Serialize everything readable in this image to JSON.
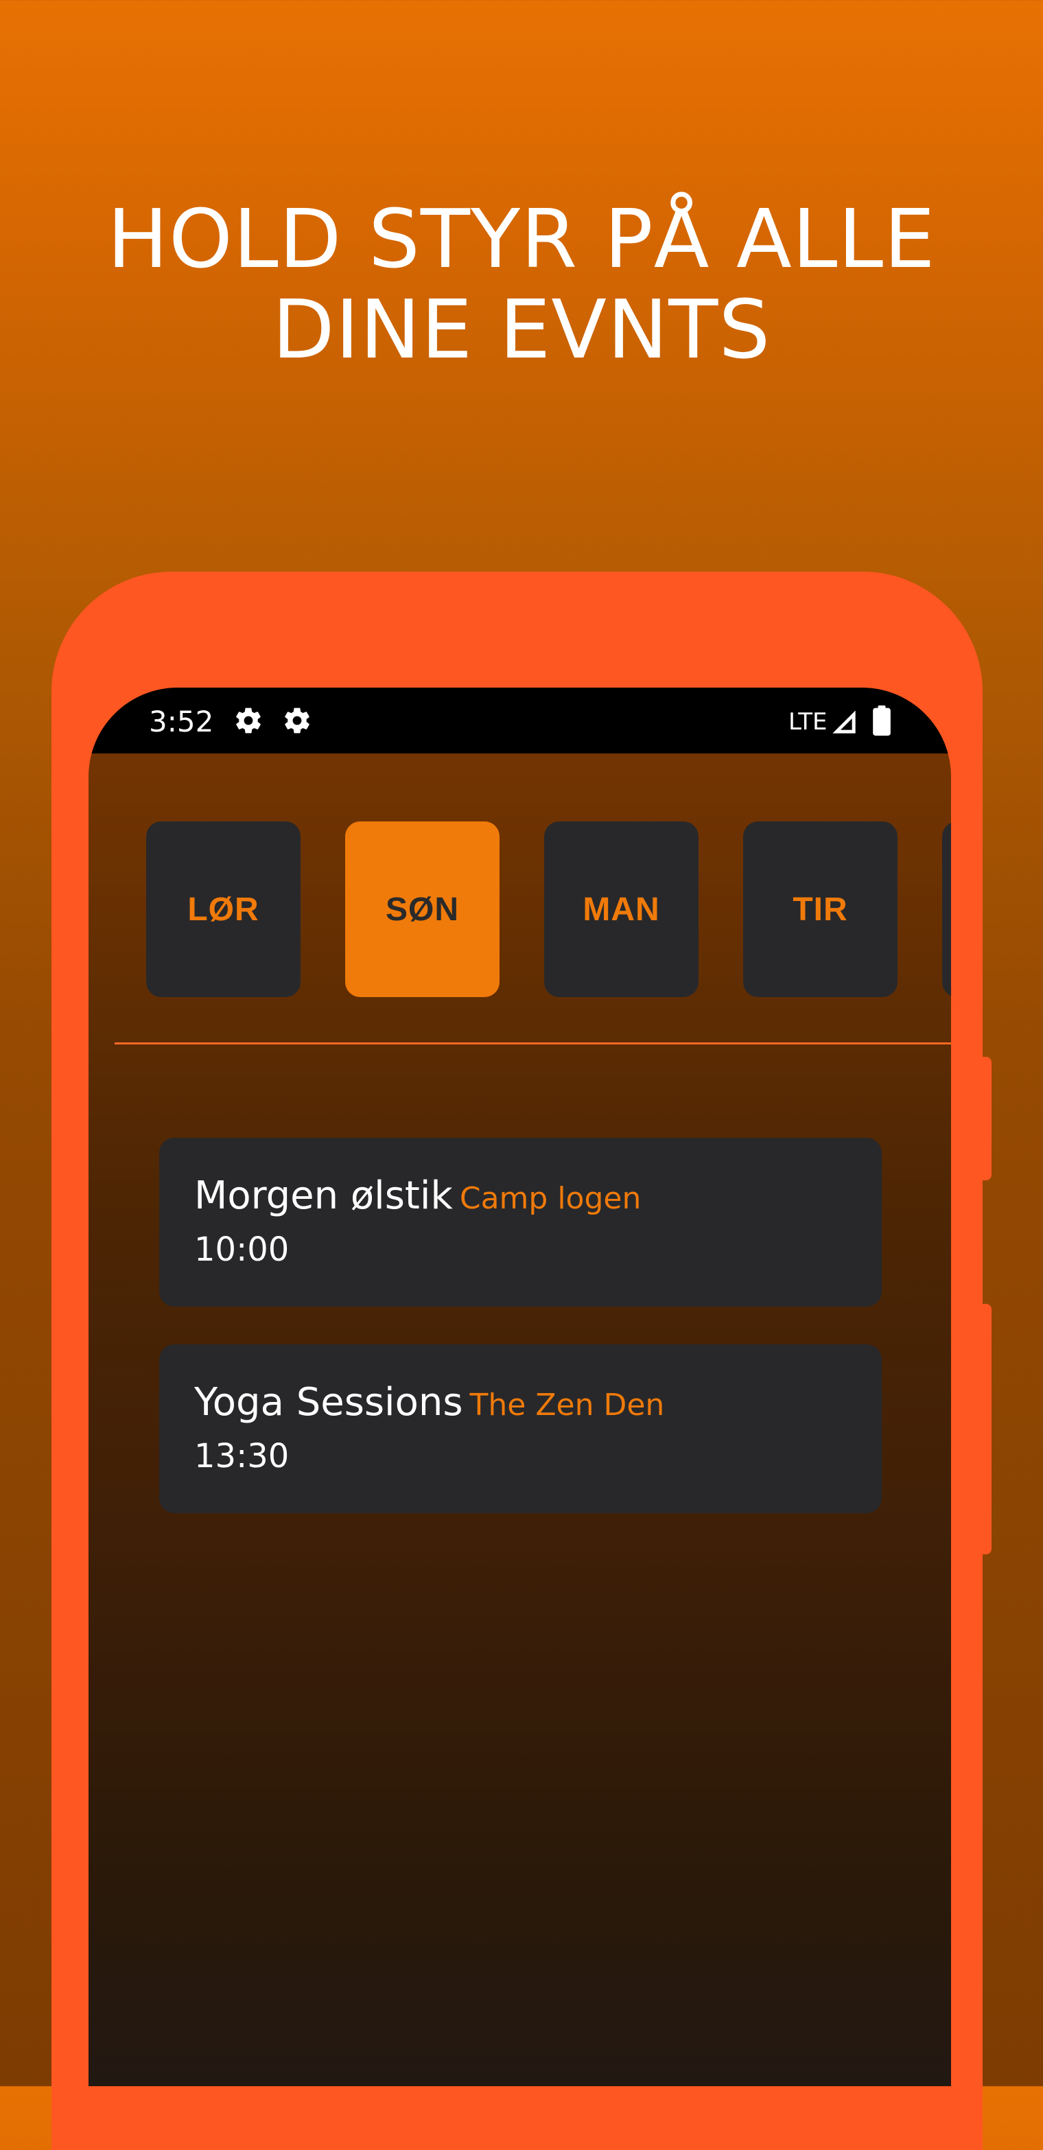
{
  "headline": {
    "line1": "HOLD STYR PÅ ALLE",
    "line2": "DINE EVNTS"
  },
  "status_bar": {
    "time": "3:52",
    "network": "LTE",
    "icons": [
      "gear-icon",
      "gear-icon",
      "signal-icon",
      "battery-icon"
    ]
  },
  "days": [
    {
      "label": "LØR",
      "selected": false
    },
    {
      "label": "SØN",
      "selected": true
    },
    {
      "label": "MAN",
      "selected": false
    },
    {
      "label": "TIR",
      "selected": false
    },
    {
      "label": "",
      "selected": false
    }
  ],
  "events": [
    {
      "name": "Morgen ølstik",
      "venue": "Camp logen",
      "time": "10:00"
    },
    {
      "name": "Yoga Sessions",
      "venue": "The Zen Den",
      "time": "13:30"
    }
  ],
  "colors": {
    "accent": "#f07a0a",
    "frame": "#ff5722",
    "card": "#28282a"
  }
}
